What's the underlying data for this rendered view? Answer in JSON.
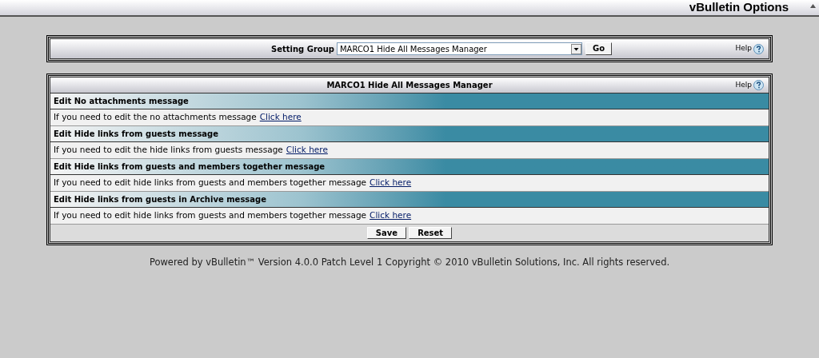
{
  "window": {
    "title": "vBulletin Options"
  },
  "setting_group": {
    "label": "Setting Group",
    "value": "MARCO1 Hide All Messages Manager",
    "go_button": "Go",
    "help": "Help"
  },
  "panel": {
    "title": "MARCO1 Hide All Messages Manager",
    "help": "Help",
    "sections": [
      {
        "heading": "Edit No attachments message",
        "text": "If you need to edit the no attachments message",
        "link": "Click here"
      },
      {
        "heading": "Edit Hide links from guests message",
        "text": "If you need to edit the hide links from guests message",
        "link": "Click here"
      },
      {
        "heading": "Edit Hide links from guests and members together message",
        "text": "If you need to edit hide links from guests and members together message",
        "link": "Click here"
      },
      {
        "heading": "Edit Hide links from guests in Archive message",
        "text": "If you need to edit hide links from guests and members together message",
        "link": "Click here"
      }
    ],
    "buttons": [
      "Save",
      "Reset"
    ]
  },
  "footer": "Powered by vBulletin™ Version 4.0.0 Patch Level 1 Copyright © 2010 vBulletin Solutions, Inc. All rights reserved."
}
